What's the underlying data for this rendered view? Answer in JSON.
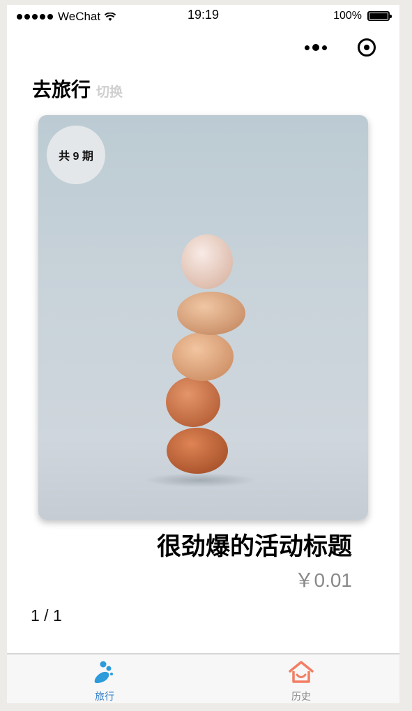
{
  "status_bar": {
    "carrier": "WeChat",
    "time": "19:19",
    "battery": "100%"
  },
  "header": {
    "title": "去旅行",
    "switch_label": "切换"
  },
  "card": {
    "badge": "共 9 期",
    "image": "stacked-eggs-photo"
  },
  "activity": {
    "title": "很劲爆的活动标题",
    "price": "￥0.01"
  },
  "pager": "1 / 1",
  "tabbar": {
    "tabs": [
      {
        "label": "旅行",
        "icon": "travel-icon",
        "active": true,
        "color": "#2b7ac9"
      },
      {
        "label": "历史",
        "icon": "home-history-icon",
        "active": false,
        "color": "#f27e64"
      }
    ]
  }
}
